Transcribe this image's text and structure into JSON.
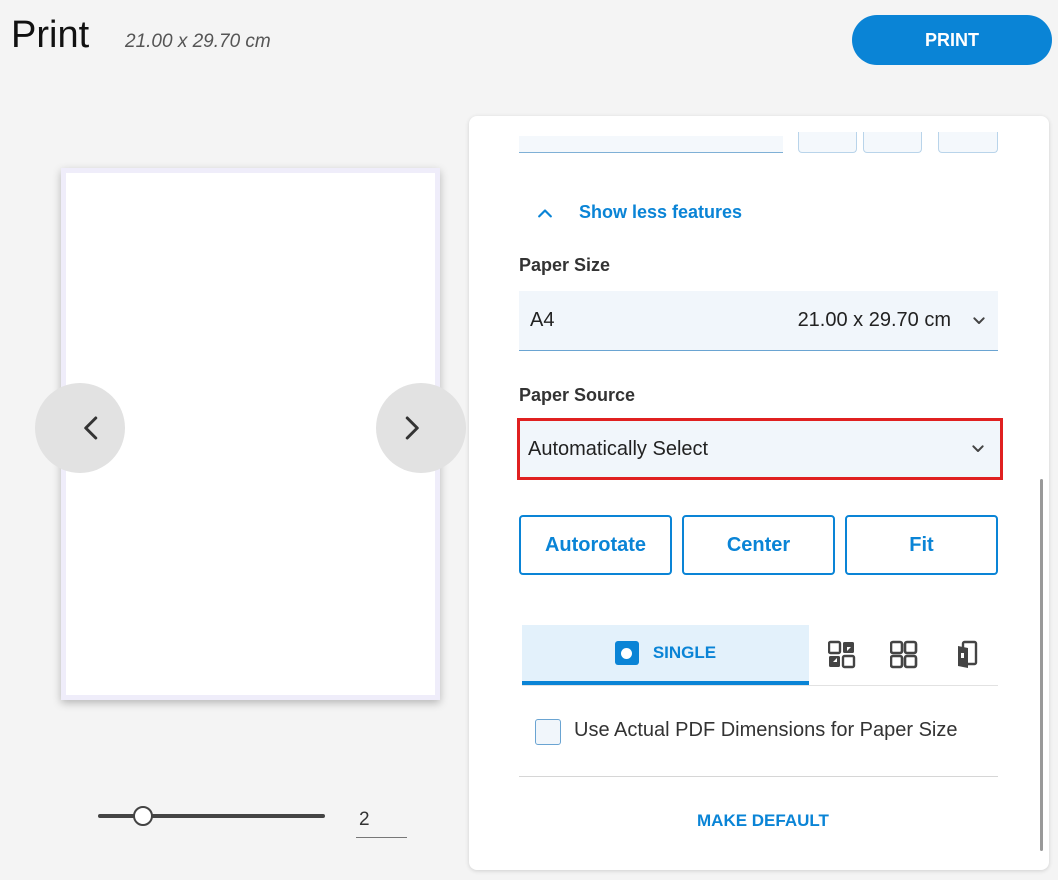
{
  "header": {
    "title": "Print",
    "paper_dimensions": "21.00 x 29.70 cm",
    "print_label": "PRINT"
  },
  "preview": {
    "page_number": "2",
    "zoom_level": 0.2
  },
  "settings": {
    "show_less_label": "Show less features",
    "paper_size": {
      "label": "Paper Size",
      "value": "A4",
      "dimensions": "21.00 x 29.70 cm"
    },
    "paper_source": {
      "label": "Paper Source",
      "value": "Automatically Select"
    },
    "options": {
      "autorotate": "Autorotate",
      "center": "Center",
      "fit": "Fit"
    },
    "layout": {
      "single_label": "SINGLE",
      "icons": [
        "tile-icon",
        "multiple-icon",
        "booklet-icon"
      ]
    },
    "pdf_dimensions_label": "Use Actual PDF Dimensions for Paper Size",
    "make_default_label": "MAKE DEFAULT"
  },
  "colors": {
    "accent": "#0a84d6",
    "highlight": "#e02020",
    "background": "#f4f4f4"
  }
}
